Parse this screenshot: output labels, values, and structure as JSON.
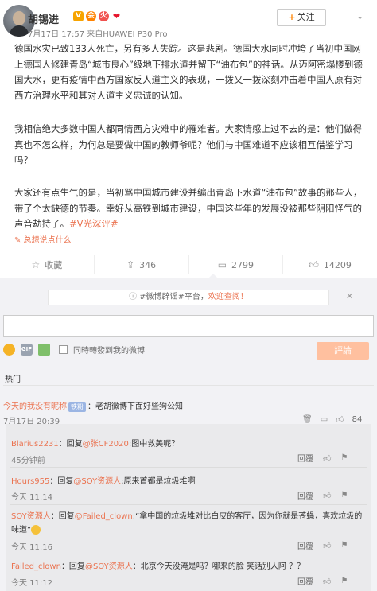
{
  "post": {
    "author": "胡锡进",
    "badges": [
      "V",
      "会",
      "火",
      "❤"
    ],
    "timestamp": "7月17日 17:57",
    "source": "来自HUAWEI P30 Pro",
    "follow_label": "关注",
    "paragraphs": [
      "德国水灾已致133人死亡，另有多人失踪。这是悲剧。德国大水同时冲垮了当初中国网上德国人修建青岛“城市良心”级地下排水道并留下“油布包”的神话。从迈阿密塌楼到德国大水，更有疫情中西方国家反人道主义的表现，一拨又一拨深刻冲击着中国人原有对西方治理水平和其对人道主义忠诚的认知。",
      "我相信绝大多数中国人都同情西方灾难中的罹难者。大家情感上过不去的是：他们做得真也不怎么样，为何总是要做中国的教师爷呢？他们与中国难道不应该相互借鉴学习吗？",
      "大家还有点生气的是，当初骂中国城市建设并编出青岛下水道“油布包”故事的那些人，带了个太缺德的节奏。幸好从高铁到城市建设，中国这些年的发展没被那些阴阳怪气的声音劫持了。"
    ],
    "hashtag": "#V光深评#",
    "translate_label": "总想说点什么"
  },
  "actions": {
    "favorite": "收藏",
    "repost": "346",
    "comment": "2799",
    "like": "14209"
  },
  "comment_box": {
    "rumor_prefix": "#微博辟谣#平台，",
    "rumor_link": "欢迎查阅！",
    "repost_option": "同時轉發到我的微博",
    "submit_label": "評論"
  },
  "comments_header": "热门",
  "top_comment": {
    "user": "今天的我没有昵称",
    "fan_badge": "铁粉",
    "text": "：老胡微博下面好些狗公知",
    "time": "7月17日 20:39",
    "likes": "84"
  },
  "replies": [
    {
      "user": "Blarius2231",
      "text": "：回复",
      "mention": "@张CF2020",
      "rest": ":图中救美呢？",
      "time": "45分钟前",
      "reply_label": "回覆"
    },
    {
      "user": "Hours955",
      "text": "：回复",
      "mention": "@SOY资源人",
      "rest": ":原来首都是垃圾堆啊",
      "time": "今天 11:14",
      "reply_label": "回覆"
    },
    {
      "user": "SOY资源人",
      "text": "：回复",
      "mention": "@Failed_clown",
      "rest": ":“拿中国的垃圾堆对比白皮的客厅，因为你就是苍蝇，喜欢垃圾的味道”",
      "time": "今天 11:16",
      "reply_label": "回覆"
    },
    {
      "user": "Failed_clown",
      "text": "：回复",
      "mention": "@SOY资源人",
      "rest": "：北京今天没淹是吗？哪来的脸 笑话别人阿 ？？",
      "time": "今天 11:12",
      "reply_label": "回覆"
    }
  ]
}
